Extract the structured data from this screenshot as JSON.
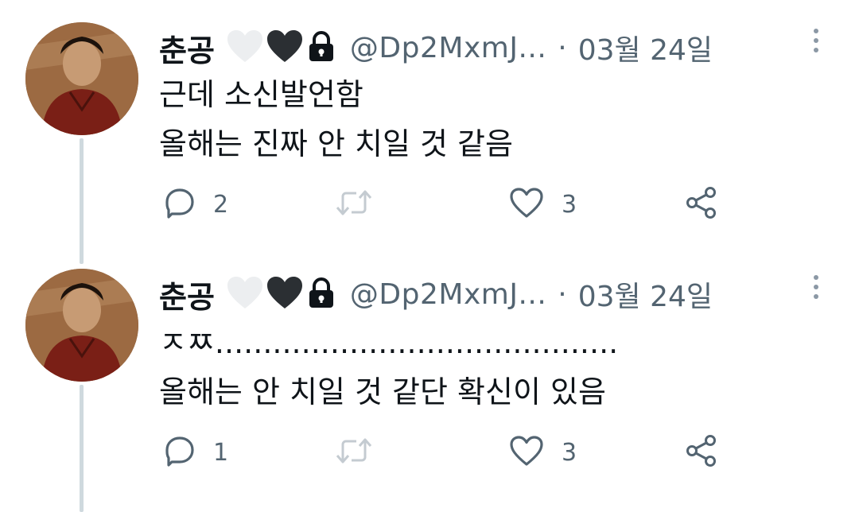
{
  "tweets": [
    {
      "author_name": "춘공",
      "handle": "@Dp2MxmJ...",
      "separator": "·",
      "date": "03월 24일",
      "lines": [
        "근데 소신발언함",
        "올해는 진짜 안 치일 것 같음"
      ],
      "replies": "2",
      "retweets": "",
      "likes": "3",
      "icons": [
        "white-heart-icon",
        "black-heart-icon",
        "lock-icon",
        "more-icon",
        "reply-icon",
        "retweet-icon",
        "like-icon",
        "share-icon"
      ]
    },
    {
      "author_name": "춘공",
      "handle": "@Dp2MxmJ...",
      "separator": "·",
      "date": "03월 24일",
      "lines": [
        "ㅈㅉ..........................................",
        "올해는 안 치일 것 같단 확신이 있음"
      ],
      "replies": "1",
      "retweets": "",
      "likes": "3",
      "icons": [
        "white-heart-icon",
        "black-heart-icon",
        "lock-icon",
        "more-icon",
        "reply-icon",
        "retweet-icon",
        "like-icon",
        "share-icon"
      ]
    }
  ],
  "colors": {
    "text": "#0f1419",
    "secondary": "#536471",
    "thread_line": "#cfd9de",
    "icon": "#536471"
  }
}
